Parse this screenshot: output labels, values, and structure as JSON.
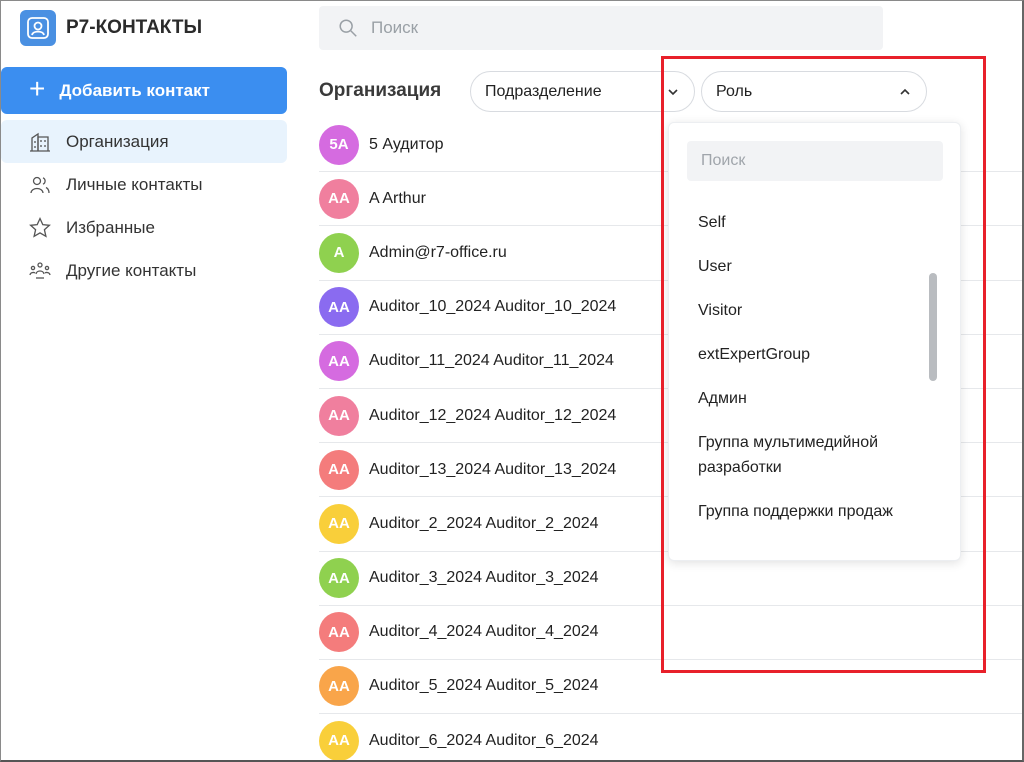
{
  "app": {
    "title": "Р7-КОНТАКТЫ"
  },
  "sidebar": {
    "add_label": "Добавить контакт",
    "items": [
      {
        "label": "Организация",
        "icon": "building-icon",
        "active": true
      },
      {
        "label": "Личные контакты",
        "icon": "users-icon"
      },
      {
        "label": "Избранные",
        "icon": "star-icon"
      },
      {
        "label": "Другие контакты",
        "icon": "group-icon"
      }
    ]
  },
  "search": {
    "placeholder": "Поиск"
  },
  "main": {
    "title": "Организация",
    "filters": {
      "subdivision": "Подразделение",
      "role": "Роль"
    }
  },
  "contacts": [
    {
      "initials": "5А",
      "name": "5 Аудитор",
      "color": "#d56be0"
    },
    {
      "initials": "AA",
      "name": "A Arthur",
      "color": "#f07f9e"
    },
    {
      "initials": "A",
      "name": "Admin@r7-office.ru",
      "color": "#8fd14f"
    },
    {
      "initials": "AA",
      "name": "Auditor_10_2024 Auditor_10_2024",
      "color": "#8a6bf0"
    },
    {
      "initials": "AA",
      "name": "Auditor_11_2024 Auditor_11_2024",
      "color": "#d56be0"
    },
    {
      "initials": "AA",
      "name": "Auditor_12_2024 Auditor_12_2024",
      "color": "#f07f9e"
    },
    {
      "initials": "AA",
      "name": "Auditor_13_2024 Auditor_13_2024",
      "color": "#f47c7c"
    },
    {
      "initials": "AA",
      "name": "Auditor_2_2024 Auditor_2_2024",
      "color": "#f9cf3a"
    },
    {
      "initials": "AA",
      "name": "Auditor_3_2024 Auditor_3_2024",
      "color": "#8fd14f"
    },
    {
      "initials": "AA",
      "name": "Auditor_4_2024 Auditor_4_2024",
      "color": "#f47c7c"
    },
    {
      "initials": "AA",
      "name": "Auditor_5_2024 Auditor_5_2024",
      "color": "#f9a54a"
    },
    {
      "initials": "AA",
      "name": "Auditor_6_2024 Auditor_6_2024",
      "color": "#f9cf3a"
    }
  ],
  "role_dropdown": {
    "search_placeholder": "Поиск",
    "options": [
      "Self",
      "User",
      "Visitor",
      "extExpertGroup",
      "Админ",
      "Группа мультимедийной разработки",
      "Группа поддержки продаж"
    ]
  },
  "colors": {
    "accent": "#3b8ef0",
    "highlight": "#e8202a"
  }
}
